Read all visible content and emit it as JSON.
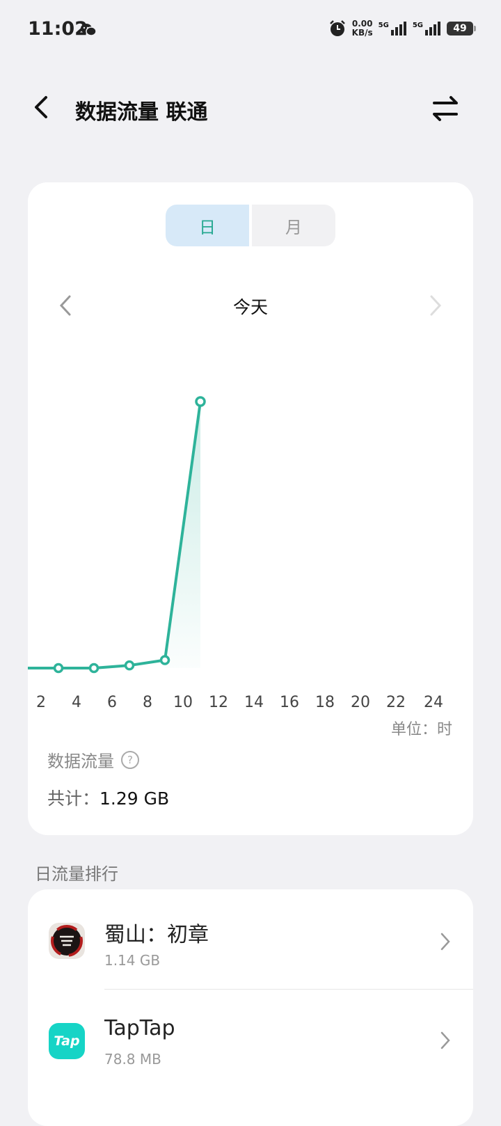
{
  "status_bar": {
    "time": "11:02",
    "speed_value": "0.00",
    "speed_unit": "KB/s",
    "sim1_label": "5G",
    "sim2_label": "5G",
    "battery": "49"
  },
  "header": {
    "title": "数据流量 联通"
  },
  "period_tabs": {
    "day": "日",
    "month": "月",
    "selected": "day"
  },
  "date_label": "今天",
  "chart_data": {
    "type": "line",
    "x": [
      1,
      3,
      5,
      7,
      9,
      11
    ],
    "values": [
      0,
      0,
      0,
      0.005,
      0.015,
      0.5
    ],
    "highlight_index": 5,
    "x_ticks": [
      "2",
      "4",
      "6",
      "8",
      "10",
      "12",
      "14",
      "16",
      "18",
      "20",
      "22",
      "24"
    ],
    "xlim": [
      1,
      25
    ],
    "ylim": [
      0,
      0.5
    ],
    "unit_label": "单位：时",
    "line_color": "#2eb39a"
  },
  "summary": {
    "label": "数据流量",
    "help_glyph": "?",
    "total_prefix": "共计：",
    "total_value": "1.29 GB"
  },
  "ranking": {
    "title": "日流量排行",
    "apps": [
      {
        "name": "蜀山：初章",
        "size": "1.14 GB",
        "icon": "shushan-app-icon"
      },
      {
        "name": "TapTap",
        "size": "78.8 MB",
        "icon": "taptap-app-icon",
        "icon_text": "Tap"
      }
    ]
  },
  "colors": {
    "accent": "#2eb39a",
    "tab_selected_bg": "#d7e9f8",
    "taptap": "#16d4c6"
  }
}
